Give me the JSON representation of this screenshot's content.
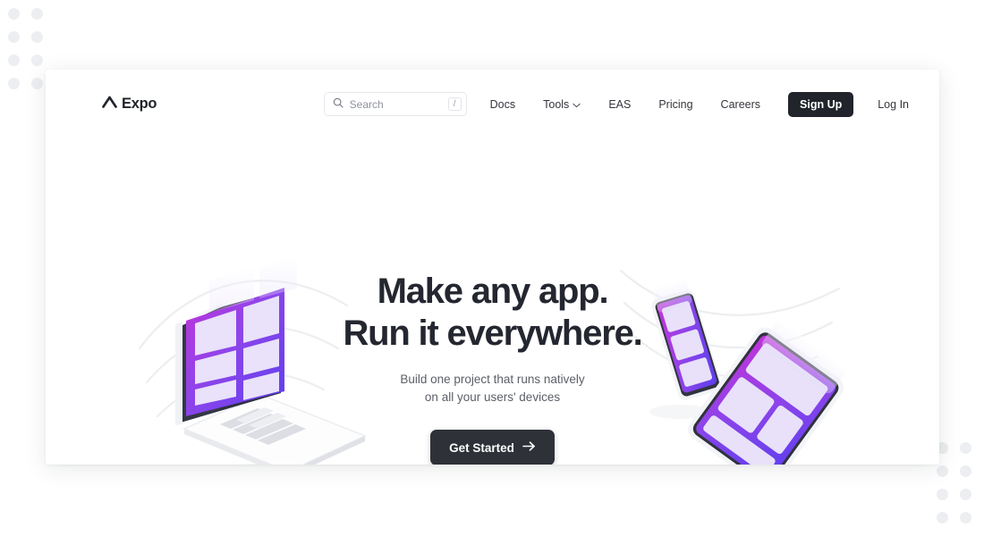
{
  "site": {
    "brand_name": "Expo",
    "logo_icon": "expo-caret-logo"
  },
  "colors": {
    "page_background": "#ffffff",
    "card_background": "#ffffff",
    "text_primary": "#242730",
    "text_secondary": "#5b6068",
    "button_dark": "#21242b",
    "cta_dark": "#2e3138",
    "dot_grid": "#eceef1",
    "accent_magenta": "#c434d9",
    "accent_violet": "#6746f0",
    "accent_lavender": "#e4dcf8"
  },
  "nav": {
    "search": {
      "placeholder": "Search",
      "icon": "search-icon",
      "shortcut_key": "/"
    },
    "links": [
      {
        "label": "Docs",
        "has_dropdown": false
      },
      {
        "label": "Tools",
        "has_dropdown": true
      },
      {
        "label": "EAS",
        "has_dropdown": false
      },
      {
        "label": "Pricing",
        "has_dropdown": false
      },
      {
        "label": "Careers",
        "has_dropdown": false
      }
    ],
    "signup_label": "Sign Up",
    "login_label": "Log In"
  },
  "hero": {
    "headline_line1": "Make any app.",
    "headline_line2": "Run it everywhere.",
    "subhead_line1": "Build one project that runs natively",
    "subhead_line2": "on all your users' devices",
    "cta_label": "Get Started",
    "cta_icon": "arrow-right-icon",
    "illustration_left": "isometric-laptop",
    "illustration_right": "isometric-phone-and-tablet"
  }
}
